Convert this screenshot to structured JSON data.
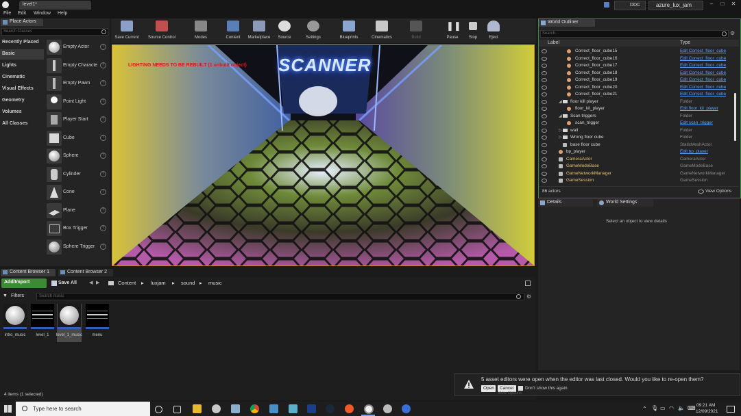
{
  "app": {
    "tab_title": "level1*",
    "ddc_label": "DDC",
    "project_name": "azure_lux_jam"
  },
  "menu": [
    "File",
    "Edit",
    "Window",
    "Help"
  ],
  "place_actors": {
    "title": "Place Actors",
    "search_placeholder": "Search Classes",
    "categories": [
      "Recently Placed",
      "Basic",
      "Lights",
      "Cinematic",
      "Visual Effects",
      "Geometry",
      "Volumes",
      "All Classes"
    ],
    "items": [
      "Empty Actor",
      "Empty Characte",
      "Empty Pawn",
      "Point Light",
      "Player Start",
      "Cube",
      "Sphere",
      "Cylinder",
      "Cone",
      "Plane",
      "Box Trigger",
      "Sphere Trigger"
    ]
  },
  "toolbar": [
    "Save Current",
    "Source Control",
    "Modes",
    "Content",
    "Marketplace",
    "Source",
    "Settings",
    "Blueprints",
    "Cinematics",
    "Build",
    "Pause",
    "Stop",
    "Eject"
  ],
  "viewport": {
    "warning": "LIGHTING NEEDS TO BE REBUILT (1 unbuilt object)",
    "sign_text": "SCANNER"
  },
  "outliner": {
    "title": "World Outliner",
    "search_placeholder": "Search...",
    "col_label": "Label",
    "col_type": "Type",
    "rows": [
      {
        "label": "Correct_floor_cube15",
        "type": "Edit Correct_floor_cube"
      },
      {
        "label": "Correct_floor_cube16",
        "type": "Edit Correct_floor_cube"
      },
      {
        "label": "Correct_floor_cube17",
        "type": "Edit Correct_floor_cube"
      },
      {
        "label": "Correct_floor_cube18",
        "type": "Edit Correct_floor_cube"
      },
      {
        "label": "Correct_floor_cube19",
        "type": "Edit Correct_floor_cube"
      },
      {
        "label": "Correct_floor_cube20",
        "type": "Edit Correct_floor_cube"
      },
      {
        "label": "Correct_floor_cube21",
        "type": "Edit Correct_floor_cube"
      },
      {
        "label": "floor kill player",
        "type": "Folder"
      },
      {
        "label": "floor_kil_player",
        "type": "Edit floor_kil_player"
      },
      {
        "label": "Scan triggers",
        "type": "Folder"
      },
      {
        "label": "scan_trigger",
        "type": "Edit scan_trigger"
      },
      {
        "label": "wall",
        "type": "Folder"
      },
      {
        "label": "Wrong floor cube",
        "type": "Folder"
      },
      {
        "label": "base floor cube",
        "type": "StaticMeshActor"
      },
      {
        "label": "bp_player",
        "type": "Edit bp_player"
      },
      {
        "label": "CameraActor",
        "type": "CameraActor"
      },
      {
        "label": "GameModeBase",
        "type": "GameModeBase"
      },
      {
        "label": "GameNetworkManager",
        "type": "GameNetworkManager"
      },
      {
        "label": "GameSession",
        "type": "GameSession"
      }
    ],
    "actor_count": "86 actors",
    "view_options": "View Options"
  },
  "details": {
    "tab_details": "Details",
    "tab_world": "World Settings",
    "empty_text": "Select an object to view details"
  },
  "content_browser": {
    "tab1": "Content Browser 1",
    "tab2": "Content Browser 2",
    "add_import": "Add/Import",
    "save_all": "Save All",
    "path": [
      "Content",
      "luxjam",
      "sound",
      "music"
    ],
    "filters": "Filters",
    "search_placeholder": "Search music",
    "assets": [
      "intro_music",
      "level_1",
      "level_1_music",
      "menu"
    ],
    "status": "4 items (1 selected)"
  },
  "notification": {
    "message": "5 asset editors were open when the editor was last closed. Would you like to re-open them?",
    "open": "Open",
    "cancel": "Cancel",
    "dont_show": "Don't show this again",
    "view_options_behind": "View Options"
  },
  "taskbar": {
    "search_placeholder": "Type here to search",
    "time": "09:21 AM",
    "date": "12/09/2021"
  }
}
